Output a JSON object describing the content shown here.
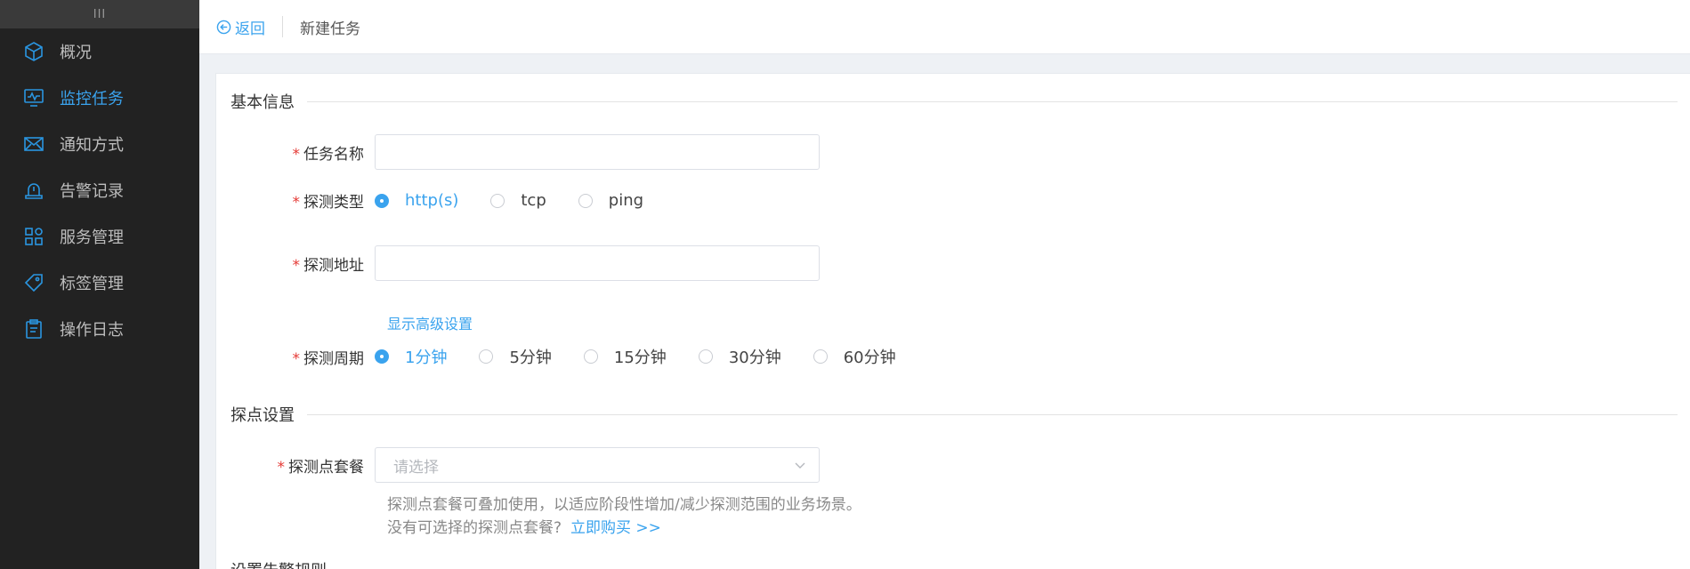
{
  "sidebar": {
    "handle": "III",
    "items": [
      {
        "label": "概况",
        "icon": "cube-icon"
      },
      {
        "label": "监控任务",
        "icon": "monitor-icon",
        "active": true
      },
      {
        "label": "通知方式",
        "icon": "envelope-icon"
      },
      {
        "label": "告警记录",
        "icon": "alarm-icon"
      },
      {
        "label": "服务管理",
        "icon": "grid-icon"
      },
      {
        "label": "标签管理",
        "icon": "tag-icon"
      },
      {
        "label": "操作日志",
        "icon": "clipboard-icon"
      }
    ]
  },
  "topbar": {
    "back_label": "返回",
    "page_title": "新建任务"
  },
  "form": {
    "basic_section": "基本信息",
    "task_name": {
      "label": "任务名称",
      "value": ""
    },
    "probe_type": {
      "label": "探测类型",
      "options": [
        "http(s)",
        "tcp",
        "ping"
      ],
      "selected": "http(s)"
    },
    "probe_address": {
      "label": "探测地址",
      "value": ""
    },
    "advanced_link": "显示高级设置",
    "probe_period": {
      "label": "探测周期",
      "options": [
        "1分钟",
        "5分钟",
        "15分钟",
        "30分钟",
        "60分钟"
      ],
      "selected": "1分钟"
    },
    "probe_section": "探点设置",
    "probe_package": {
      "label": "探测点套餐",
      "placeholder": "请选择"
    },
    "help_line1": "探测点套餐可叠加使用，以适应阶段性增加/减少探测范围的业务场景。",
    "help_line2": "没有可选择的探测点套餐?",
    "buy_link": "立即购买 >>",
    "alarm_section": "设置告警规则"
  },
  "colors": {
    "accent": "#3aa3ee",
    "sidebar_bg": "#222222",
    "required": "#e53935"
  }
}
